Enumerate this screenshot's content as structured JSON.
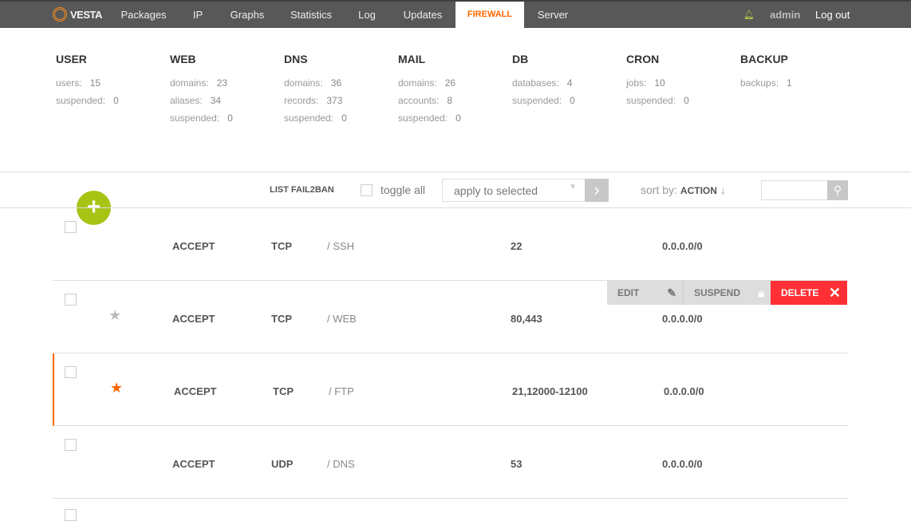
{
  "nav": {
    "logo": "VESTA",
    "items": [
      "Packages",
      "IP",
      "Graphs",
      "Statistics",
      "Log",
      "Updates",
      "FIREWALL",
      "Server"
    ],
    "active": "FIREWALL",
    "user": "admin",
    "logout": "Log out"
  },
  "stats": [
    {
      "title": "USER",
      "lines": [
        [
          "users:",
          "15"
        ],
        [
          "suspended:",
          "0"
        ]
      ]
    },
    {
      "title": "WEB",
      "lines": [
        [
          "domains:",
          "23"
        ],
        [
          "aliases:",
          "34"
        ],
        [
          "suspended:",
          "0"
        ]
      ]
    },
    {
      "title": "DNS",
      "lines": [
        [
          "domains:",
          "36"
        ],
        [
          "records:",
          "373"
        ],
        [
          "suspended:",
          "0"
        ]
      ]
    },
    {
      "title": "MAIL",
      "lines": [
        [
          "domains:",
          "26"
        ],
        [
          "accounts:",
          "8"
        ],
        [
          "suspended:",
          "0"
        ]
      ]
    },
    {
      "title": "DB",
      "lines": [
        [
          "databases:",
          "4"
        ],
        [
          "suspended:",
          "0"
        ]
      ]
    },
    {
      "title": "CRON",
      "lines": [
        [
          "jobs:",
          "10"
        ],
        [
          "suspended:",
          "0"
        ]
      ]
    },
    {
      "title": "BACKUP",
      "lines": [
        [
          "backups:",
          "1"
        ]
      ]
    }
  ],
  "toolbar": {
    "list_fail2ban": "LIST FAIL2BAN",
    "toggle_all": "toggle all",
    "apply": "apply to selected",
    "sort_label": "sort by:",
    "sort_value": "ACTION",
    "sort_arrow": "↓",
    "search_placeholder": ""
  },
  "actions": {
    "edit": "EDIT",
    "suspend": "SUSPEND",
    "delete": "DELETE"
  },
  "colors": {
    "accent": "#ff6701",
    "add": "#a7c414",
    "delete": "#ff3035"
  },
  "rules": [
    {
      "action": "ACCEPT",
      "proto": "TCP",
      "service": "/ SSH",
      "port": "22",
      "ip": "0.0.0.0/0",
      "star": ""
    },
    {
      "action": "ACCEPT",
      "proto": "TCP",
      "service": "/ WEB",
      "port": "80,443",
      "ip": "0.0.0.0/0",
      "star": "★"
    },
    {
      "action": "ACCEPT",
      "proto": "TCP",
      "service": "/ FTP",
      "port": "21,12000-12100",
      "ip": "0.0.0.0/0",
      "star": "★"
    },
    {
      "action": "ACCEPT",
      "proto": "UDP",
      "service": "/ DNS",
      "port": "53",
      "ip": "0.0.0.0/0",
      "star": ""
    }
  ]
}
